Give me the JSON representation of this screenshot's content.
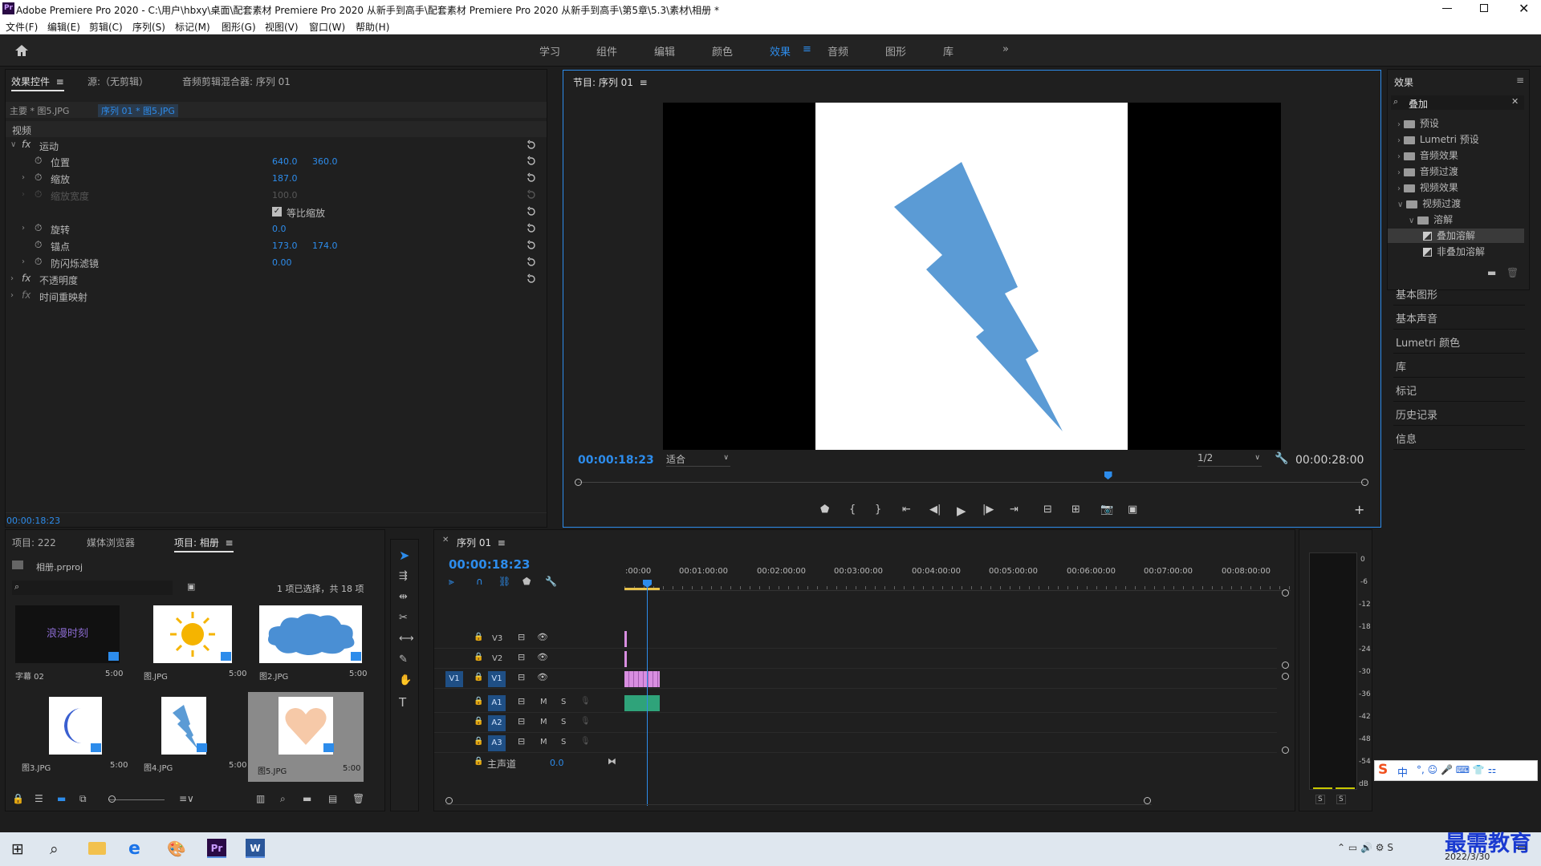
{
  "window": {
    "title": "Adobe Premiere Pro 2020 - C:\\用户\\hbxy\\桌面\\配套素材 Premiere Pro 2020 从新手到高手\\配套素材 Premiere Pro 2020 从新手到高手\\第5章\\5.3\\素材\\相册 *",
    "logo": "Pr"
  },
  "menu": [
    "文件(F)",
    "编辑(E)",
    "剪辑(C)",
    "序列(S)",
    "标记(M)",
    "图形(G)",
    "视图(V)",
    "窗口(W)",
    "帮助(H)"
  ],
  "workspaces": [
    "学习",
    "组件",
    "编辑",
    "颜色",
    "效果",
    "音频",
    "图形",
    "库"
  ],
  "active_workspace": "效果",
  "effect_controls": {
    "tabs": [
      "效果控件",
      "源:（无剪辑）",
      "音频剪辑混合器: 序列 01"
    ],
    "master": "主要 * 图5.JPG",
    "sequence": "序列 01 * 图5.JPG",
    "section_video": "视频",
    "motion": "运动",
    "position": {
      "label": "位置",
      "x": "640.0",
      "y": "360.0"
    },
    "scale": {
      "label": "缩放",
      "value": "187.0"
    },
    "scale_width": {
      "label": "缩放宽度",
      "value": "100.0"
    },
    "uniform_scale": "等比缩放",
    "rotation": {
      "label": "旋转",
      "value": "0.0"
    },
    "anchor": {
      "label": "锚点",
      "x": "173.0",
      "y": "174.0"
    },
    "anti_flicker": {
      "label": "防闪烁滤镜",
      "value": "0.00"
    },
    "opacity": "不透明度",
    "time_remap": "时间重映射",
    "timecode": "00:00:18:23"
  },
  "program": {
    "tab": "节目: 序列 01",
    "timecode": "00:00:18:23",
    "fit": "适合",
    "quality": "1/2",
    "duration": "00:00:28:00",
    "playhead_fraction": 0.674
  },
  "effects_panel": {
    "title": "效果",
    "search": "叠加",
    "items": [
      {
        "label": "预设",
        "level": 0
      },
      {
        "label": "Lumetri 预设",
        "level": 0
      },
      {
        "label": "音频效果",
        "level": 0
      },
      {
        "label": "音频过渡",
        "level": 0
      },
      {
        "label": "视频效果",
        "level": 0
      },
      {
        "label": "视频过渡",
        "level": 0,
        "open": true
      },
      {
        "label": "溶解",
        "level": 1,
        "open": true
      },
      {
        "label": "叠加溶解",
        "level": 2,
        "selected": true
      },
      {
        "label": "非叠加溶解",
        "level": 2
      }
    ],
    "side_panels": [
      "基本图形",
      "基本声音",
      "Lumetri 颜色",
      "库",
      "标记",
      "历史记录",
      "信息"
    ]
  },
  "project": {
    "tabs": [
      "项目: 222",
      "媒体浏览器",
      "项目: 相册"
    ],
    "file": "相册.prproj",
    "status": "1 项已选择，共 18 项",
    "clips": [
      {
        "name": "字幕 02",
        "dur": "5:00",
        "caption": "浪漫时刻"
      },
      {
        "name": "图.JPG",
        "dur": "5:00"
      },
      {
        "name": "图2.JPG",
        "dur": "5:00"
      },
      {
        "name": "图3.JPG",
        "dur": "5:00"
      },
      {
        "name": "图4.JPG",
        "dur": "5:00"
      },
      {
        "name": "图5.JPG",
        "dur": "5:00"
      }
    ]
  },
  "timeline": {
    "tab": "序列 01",
    "timecode": "00:00:18:23",
    "ruler": [
      ":00:00",
      "00:01:00:00",
      "00:02:00:00",
      "00:03:00:00",
      "00:04:00:00",
      "00:05:00:00",
      "00:06:00:00",
      "00:07:00:00",
      "00:08:00:00"
    ],
    "video_tracks": [
      "V3",
      "V2",
      "V1"
    ],
    "audio_tracks": [
      "A1",
      "A2",
      "A3"
    ],
    "source_patch": "V1",
    "master": {
      "label": "主声道",
      "value": "0.0"
    },
    "mute": "M",
    "solo": "S"
  },
  "meter": {
    "scale": [
      "0",
      "-6",
      "-12",
      "-18",
      "-24",
      "-30",
      "-36",
      "-42",
      "-48",
      "-54",
      "dB"
    ],
    "solo": [
      "S",
      "S"
    ]
  },
  "taskbar": {
    "date": "2022/3/30",
    "ime": "中",
    "watermark": "最需教育"
  },
  "colors": {
    "accent": "#2d8ceb",
    "bolt": "#5b9bd5",
    "clip": "#d88ee0",
    "audio_clip": "#2fa37a"
  }
}
